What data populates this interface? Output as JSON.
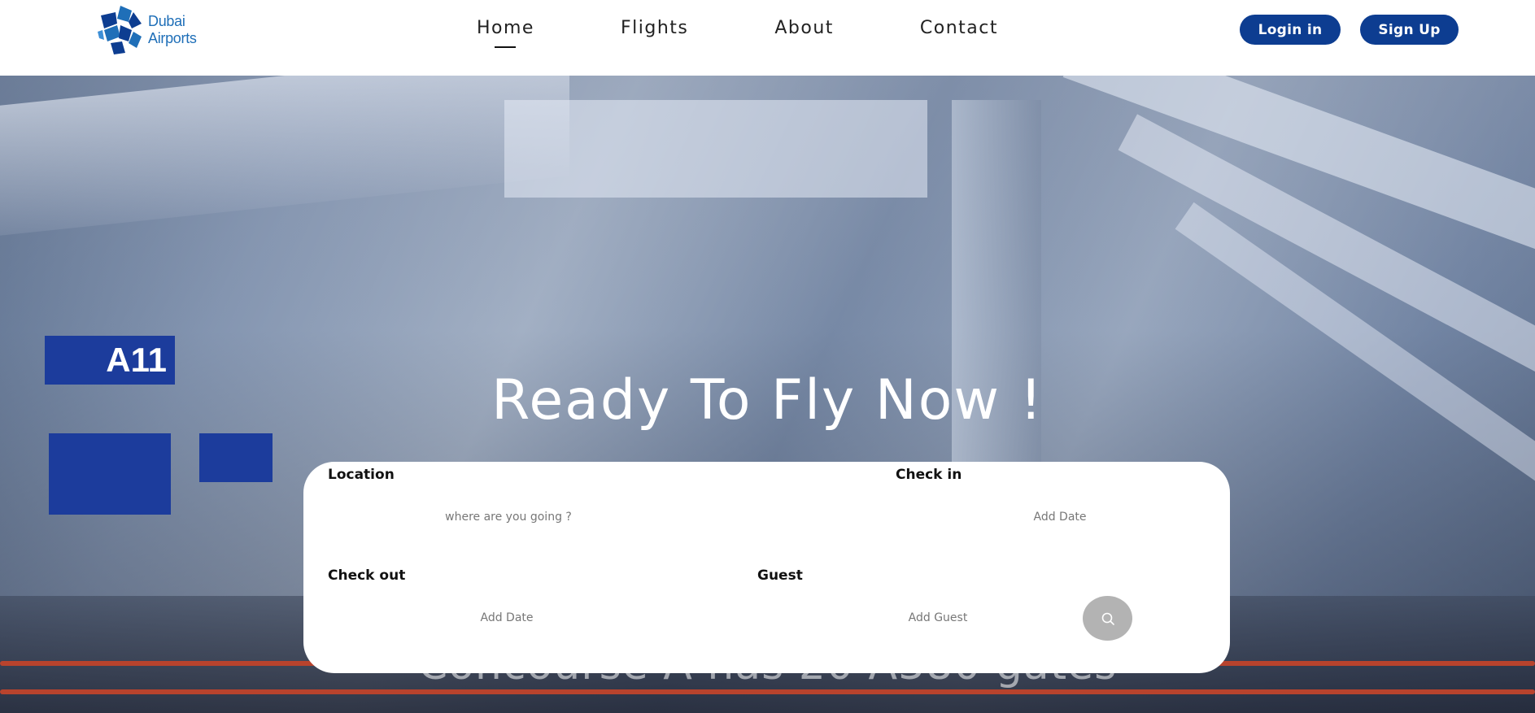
{
  "header": {
    "logo_line1": "Dubai",
    "logo_line2": "Airports",
    "nav": [
      {
        "label": "Home",
        "active": true
      },
      {
        "label": "Flights",
        "active": false
      },
      {
        "label": "About",
        "active": false
      },
      {
        "label": "Contact",
        "active": false
      }
    ],
    "login_label": "Login in",
    "signup_label": "Sign Up"
  },
  "hero": {
    "title": "Ready To Fly Now !",
    "subtitle": "Concourse A has 20 A380 gates",
    "gate_sign": "A11"
  },
  "search": {
    "location_label": "Location",
    "location_placeholder": "where are you going ?",
    "checkin_label": "Check in",
    "checkin_placeholder": "Add Date",
    "checkout_label": "Check out",
    "checkout_placeholder": "Add Date",
    "guest_label": "Guest",
    "guest_placeholder": "Add Guest",
    "search_icon": "search-icon"
  },
  "colors": {
    "brand": "#0d3d91",
    "logo": "#1f6fb8",
    "search_button": "#b3b3b3"
  }
}
